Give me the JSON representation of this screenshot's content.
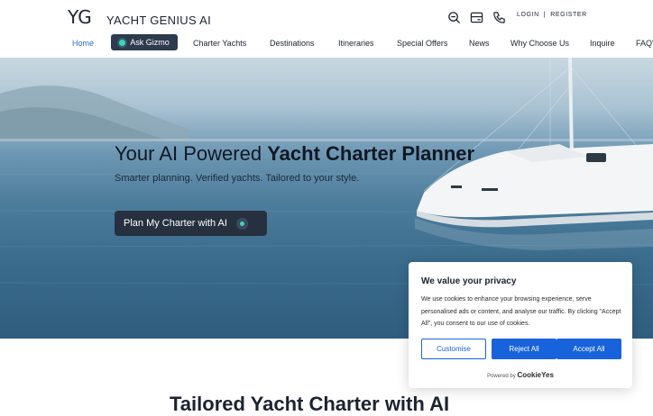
{
  "brand": {
    "logo_mark": "YG",
    "name": "YACHT GENIUS AI"
  },
  "header": {
    "icons": [
      "search-icon",
      "card-icon",
      "phone-icon"
    ],
    "login": "LOGIN",
    "separator": "|",
    "register": "REGISTER"
  },
  "nav": {
    "home": "Home",
    "ask_gizmo": "Ask Gizmo",
    "charter_yachts": "Charter Yachts",
    "destinations": "Destinations",
    "itineraries": "Itineraries",
    "special_offers": "Special Offers",
    "news": "News",
    "why_choose_us": "Why Choose Us",
    "inquire": "Inquire",
    "faqs": "FAQ'"
  },
  "hero": {
    "title_light": "Your AI Powered ",
    "title_bold": "Yacht Charter Planner",
    "subtitle": "Smarter planning. Verified yachts. Tailored to your style.",
    "cta": "Plan My Charter with AI"
  },
  "section": {
    "title": "Tailored Yacht Charter with AI"
  },
  "cookie": {
    "title": "We value your privacy",
    "text": "We use cookies to enhance your browsing experience, serve personalised ads or content, and analyse our traffic. By clicking \"Accept All\", you consent to our use of cookies.",
    "customise": "Customise",
    "reject": "Reject All",
    "accept": "Accept All",
    "powered_by": "Powered by",
    "provider": "CookieYes"
  },
  "colors": {
    "accent": "#2b6fd0",
    "dark_button": "#26303f",
    "cookie_blue": "#1863dc",
    "gizmo_glow": "#3fd2c0"
  }
}
